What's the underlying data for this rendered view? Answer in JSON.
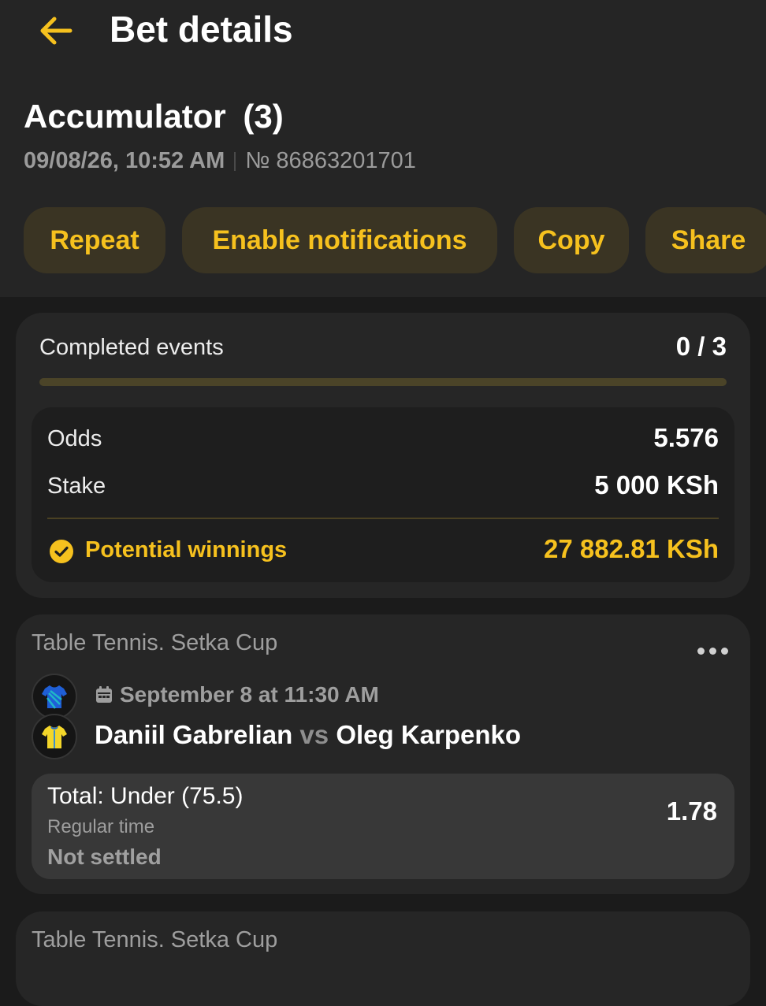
{
  "header": {
    "title": "Bet details",
    "back_icon": "arrow-left-icon",
    "accent": "#f6c11e"
  },
  "bet": {
    "type": "Accumulator",
    "count": "(3)",
    "datetime": "09/08/26, 10:52 AM",
    "number": "№ 86863201701"
  },
  "actions": [
    "Repeat",
    "Enable notifications",
    "Copy",
    "Share"
  ],
  "summary": {
    "completed_label": "Completed events",
    "completed_value": "0 / 3",
    "completed_fraction": 0,
    "odds_label": "Odds",
    "odds_value": "5.576",
    "stake_label": "Stake",
    "stake_value": "5 000 KSh",
    "winnings_label": "Potential winnings",
    "winnings_value": "27 882.81 KSh",
    "winnings_icon": "check-circle-icon"
  },
  "events": [
    {
      "league": "Table Tennis. Setka Cup",
      "date": "September 8 at 11:30 AM",
      "date_icon": "calendar-icon",
      "player1": "Daniil Gabrelian",
      "vs": "vs",
      "player2": "Oleg Karpenko",
      "market": "Total: Under (75.5)",
      "period": "Regular time",
      "status": "Not settled",
      "odds": "1.78"
    },
    {
      "league": "Table Tennis. Setka Cup"
    }
  ]
}
